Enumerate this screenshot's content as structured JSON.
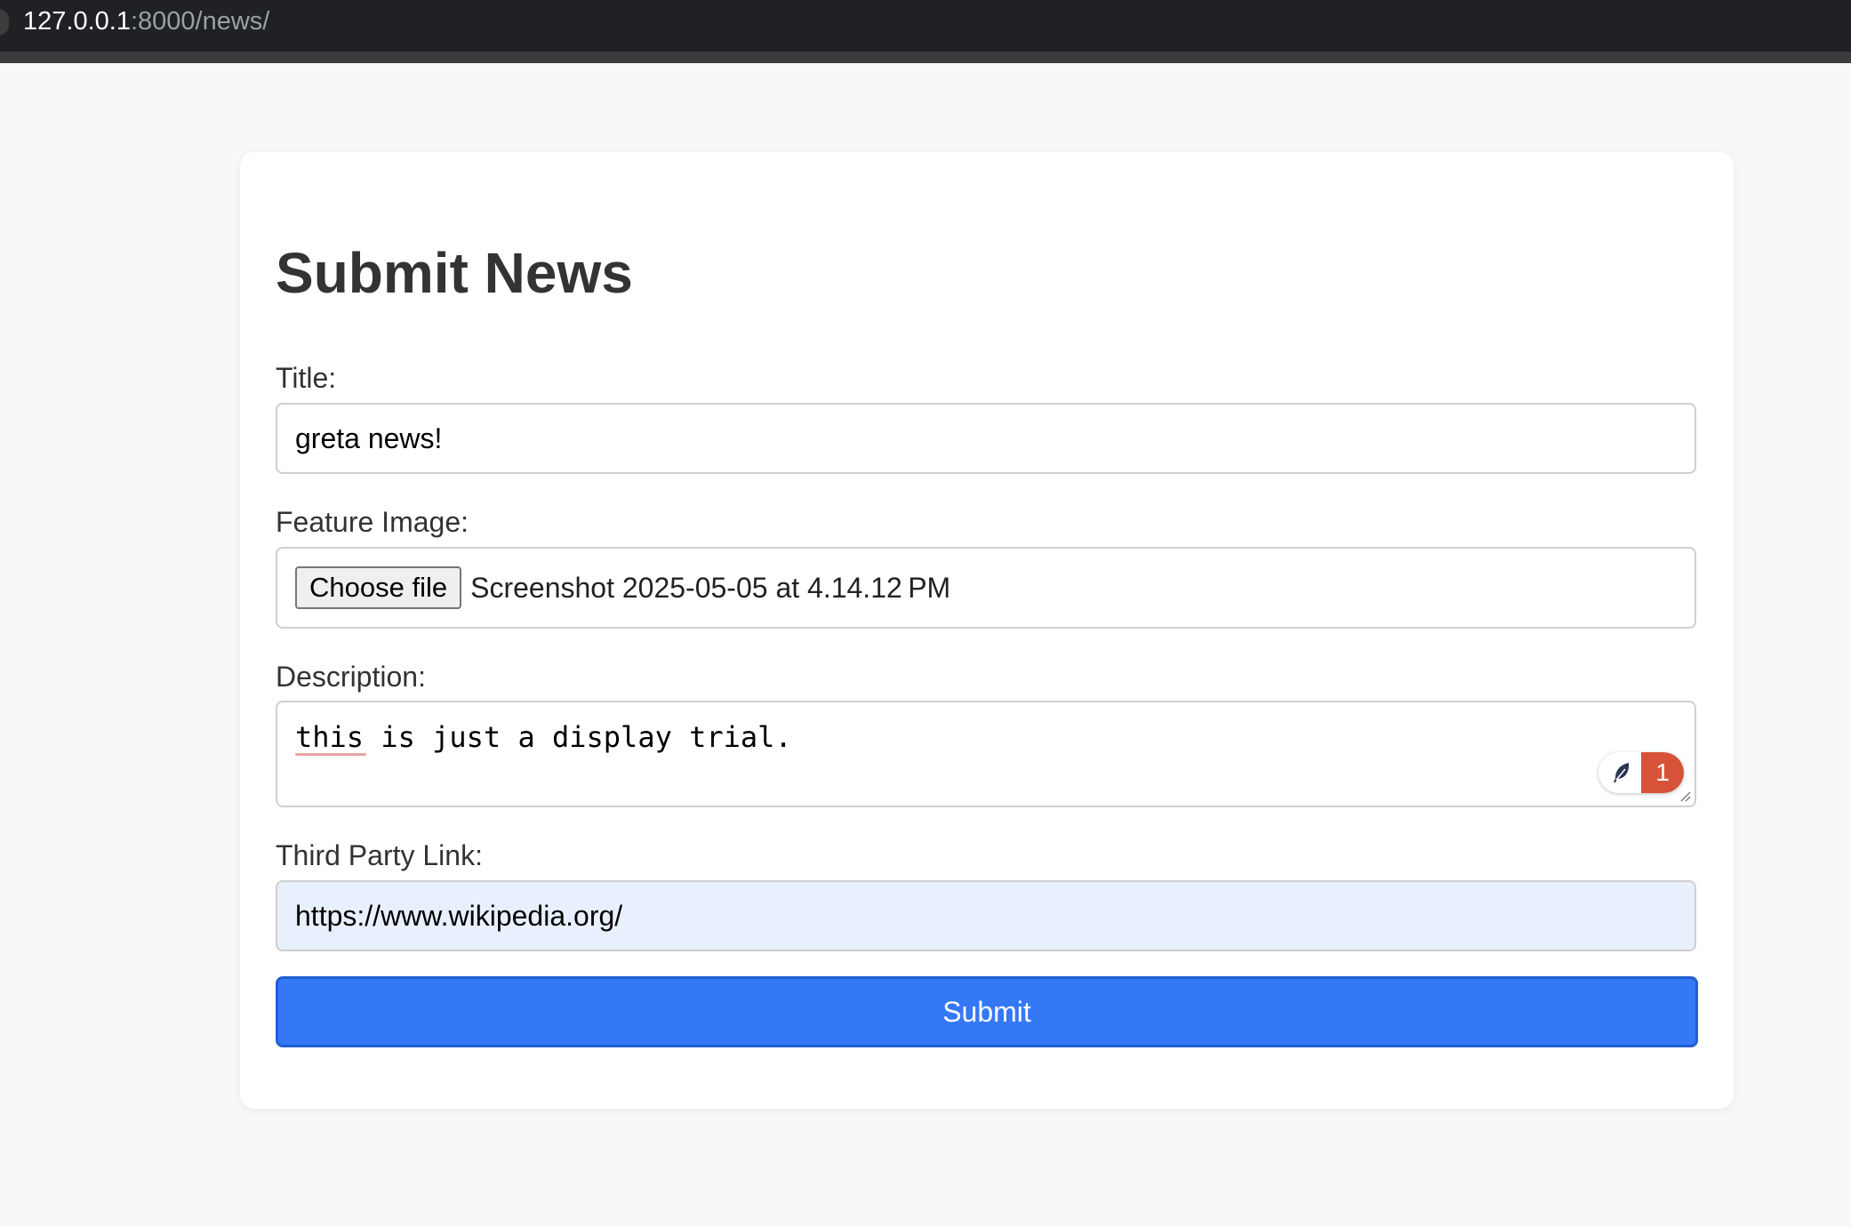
{
  "browser": {
    "url_host": "127.0.0.1",
    "url_path": ":8000/news/"
  },
  "form": {
    "title": "Submit News",
    "title_label": "Title:",
    "title_value": "greta news!",
    "image_label": "Feature Image:",
    "choose_file_label": "Choose file",
    "chosen_file_name": "Screenshot 2025-05-05 at 4.14.12 PM",
    "description_label": "Description:",
    "description_value": "this is just a display trial.",
    "grammar_issue_count": "1",
    "link_label": "Third Party Link:",
    "link_value": "https://www.wikipedia.org/",
    "submit_label": "Submit"
  },
  "colors": {
    "primary_button": "#3478f6",
    "autofill_background": "#e8f0fe",
    "grammar_badge": "#d6533a"
  },
  "icons": {
    "grammar_badge_icon": "feather-icon",
    "resize_icon": "resize-grip-icon"
  }
}
